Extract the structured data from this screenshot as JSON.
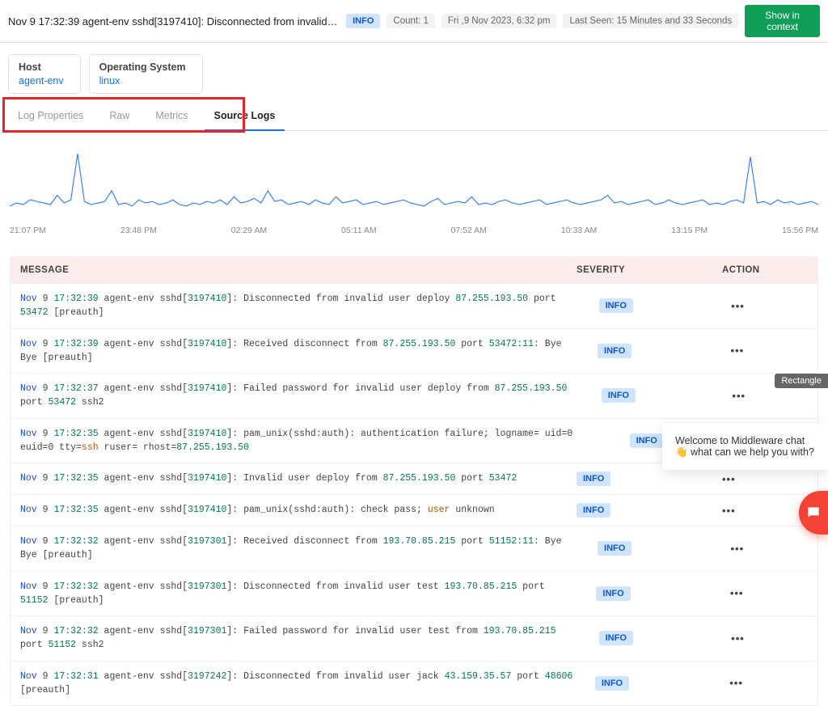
{
  "topbar": {
    "title": "Nov 9 17:32:39 agent-env sshd[3197410]: Disconnected from invalid user deploy 87.2...",
    "severity_badge": "INFO",
    "count_meta": "Count: 1",
    "date_meta": "Fri ,9 Nov 2023, 6:32 pm",
    "lastseen_meta": "Last Seen: 15 Minutes and 33 Seconds",
    "show_ctx_btn": "Show in context"
  },
  "infocards": [
    {
      "label": "Host",
      "value": "agent-env"
    },
    {
      "label": "Operating System",
      "value": "linux"
    }
  ],
  "tabs": [
    {
      "label": "Log Properties",
      "active": false
    },
    {
      "label": "Raw",
      "active": false
    },
    {
      "label": "Metrics",
      "active": false
    },
    {
      "label": "Source Logs",
      "active": true
    }
  ],
  "chart_data": {
    "type": "line",
    "title": "",
    "xlabel": "",
    "ylabel": "",
    "x_ticks": [
      "21:07 PM",
      "23:48 PM",
      "02:29 AM",
      "05:11 AM",
      "07:52 AM",
      "10:33 AM",
      "13:15 PM",
      "15:56 PM"
    ],
    "series": [
      {
        "name": "log volume",
        "values": [
          8,
          10,
          9,
          12,
          11,
          10,
          9,
          15,
          10,
          12,
          42,
          11,
          9,
          10,
          11,
          18,
          9,
          10,
          8,
          12,
          10,
          11,
          9,
          10,
          12,
          9,
          8,
          10,
          9,
          11,
          10,
          12,
          9,
          14,
          10,
          11,
          13,
          10,
          18,
          11,
          12,
          9,
          10,
          11,
          9,
          12,
          10,
          9,
          14,
          10,
          11,
          12,
          9,
          10,
          11,
          9,
          10,
          11,
          12,
          10,
          9,
          8,
          11,
          13,
          9,
          10,
          11,
          10,
          14,
          9,
          10,
          9,
          11,
          12,
          10,
          9,
          10,
          11,
          12,
          9,
          10,
          11,
          12,
          10,
          9,
          10,
          11,
          12,
          15,
          10,
          11,
          9,
          10,
          11,
          12,
          9,
          10,
          12,
          10,
          9,
          10,
          11,
          12,
          9,
          10,
          9,
          11,
          12,
          10,
          40,
          10,
          11,
          9,
          12,
          10,
          11,
          9,
          10,
          11,
          9
        ]
      }
    ],
    "ylim": [
      0,
      45
    ]
  },
  "logtable": {
    "headers": {
      "msg": "MESSAGE",
      "sev": "SEVERITY",
      "act": "ACTION"
    },
    "rows": [
      {
        "tokens": [
          {
            "t": "Nov",
            "c": "blue"
          },
          {
            "t": "  9 ",
            "c": ""
          },
          {
            "t": "17:32:39",
            "c": "teal"
          },
          {
            "t": " agent-env sshd[",
            "c": ""
          },
          {
            "t": "3197410",
            "c": "teal"
          },
          {
            "t": "]: Disconnected from invalid user deploy ",
            "c": ""
          },
          {
            "t": "87.255.193.50",
            "c": "teal"
          },
          {
            "t": " port ",
            "c": ""
          },
          {
            "t": "53472",
            "c": "teal"
          },
          {
            "t": " [preauth]",
            "c": ""
          }
        ],
        "severity": "INFO"
      },
      {
        "tokens": [
          {
            "t": "Nov",
            "c": "blue"
          },
          {
            "t": "  9 ",
            "c": ""
          },
          {
            "t": "17:32:39",
            "c": "teal"
          },
          {
            "t": " agent-env sshd[",
            "c": ""
          },
          {
            "t": "3197410",
            "c": "teal"
          },
          {
            "t": "]: Received disconnect from ",
            "c": ""
          },
          {
            "t": "87.255.193.50",
            "c": "teal"
          },
          {
            "t": " port ",
            "c": ""
          },
          {
            "t": "53472:11",
            "c": "teal"
          },
          {
            "t": ": Bye Bye [preauth]",
            "c": ""
          }
        ],
        "severity": "INFO"
      },
      {
        "tokens": [
          {
            "t": "Nov",
            "c": "blue"
          },
          {
            "t": "  9 ",
            "c": ""
          },
          {
            "t": "17:32:37",
            "c": "teal"
          },
          {
            "t": " agent-env sshd[",
            "c": ""
          },
          {
            "t": "3197410",
            "c": "teal"
          },
          {
            "t": "]: Failed password for invalid user deploy from ",
            "c": ""
          },
          {
            "t": "87.255.193.50",
            "c": "teal"
          },
          {
            "t": " port ",
            "c": ""
          },
          {
            "t": "53472",
            "c": "teal"
          },
          {
            "t": " ssh2",
            "c": ""
          }
        ],
        "severity": "INFO"
      },
      {
        "tokens": [
          {
            "t": "Nov",
            "c": "blue"
          },
          {
            "t": "  9 ",
            "c": ""
          },
          {
            "t": "17:32:35",
            "c": "teal"
          },
          {
            "t": " agent-env sshd[",
            "c": ""
          },
          {
            "t": "3197410",
            "c": "teal"
          },
          {
            "t": "]: pam_unix(sshd:auth): authentication failure; logname= uid=0 euid=0 tty=",
            "c": ""
          },
          {
            "t": "ssh",
            "c": "orange"
          },
          {
            "t": " ruser= rhost=",
            "c": ""
          },
          {
            "t": "87.255.193.50",
            "c": "teal"
          }
        ],
        "severity": "INFO"
      },
      {
        "tokens": [
          {
            "t": "Nov",
            "c": "blue"
          },
          {
            "t": "  9 ",
            "c": ""
          },
          {
            "t": "17:32:35",
            "c": "teal"
          },
          {
            "t": " agent-env sshd[",
            "c": ""
          },
          {
            "t": "3197410",
            "c": "teal"
          },
          {
            "t": "]: Invalid user deploy from ",
            "c": ""
          },
          {
            "t": "87.255.193.50",
            "c": "teal"
          },
          {
            "t": " port ",
            "c": ""
          },
          {
            "t": "53472",
            "c": "teal"
          }
        ],
        "severity": "INFO"
      },
      {
        "tokens": [
          {
            "t": "Nov",
            "c": "blue"
          },
          {
            "t": "  9 ",
            "c": ""
          },
          {
            "t": "17:32:35",
            "c": "teal"
          },
          {
            "t": " agent-env sshd[",
            "c": ""
          },
          {
            "t": "3197410",
            "c": "teal"
          },
          {
            "t": "]: pam_unix(sshd:auth): check pass; ",
            "c": ""
          },
          {
            "t": "user",
            "c": "orange"
          },
          {
            "t": " unknown",
            "c": ""
          }
        ],
        "severity": "INFO"
      },
      {
        "tokens": [
          {
            "t": "Nov",
            "c": "blue"
          },
          {
            "t": "  9 ",
            "c": ""
          },
          {
            "t": "17:32:32",
            "c": "teal"
          },
          {
            "t": " agent-env sshd[",
            "c": ""
          },
          {
            "t": "3197301",
            "c": "teal"
          },
          {
            "t": "]: Received disconnect from ",
            "c": ""
          },
          {
            "t": "193.70.85.215",
            "c": "teal"
          },
          {
            "t": " port ",
            "c": ""
          },
          {
            "t": "51152:11",
            "c": "teal"
          },
          {
            "t": ": Bye Bye [preauth]",
            "c": ""
          }
        ],
        "severity": "INFO"
      },
      {
        "tokens": [
          {
            "t": "Nov",
            "c": "blue"
          },
          {
            "t": "  9 ",
            "c": ""
          },
          {
            "t": "17:32:32",
            "c": "teal"
          },
          {
            "t": " agent-env sshd[",
            "c": ""
          },
          {
            "t": "3197301",
            "c": "teal"
          },
          {
            "t": "]: Disconnected from invalid user test ",
            "c": ""
          },
          {
            "t": "193.70.85.215",
            "c": "teal"
          },
          {
            "t": " port ",
            "c": ""
          },
          {
            "t": "51152",
            "c": "teal"
          },
          {
            "t": " [preauth]",
            "c": ""
          }
        ],
        "severity": "INFO"
      },
      {
        "tokens": [
          {
            "t": "Nov",
            "c": "blue"
          },
          {
            "t": "  9 ",
            "c": ""
          },
          {
            "t": "17:32:32",
            "c": "teal"
          },
          {
            "t": " agent-env sshd[",
            "c": ""
          },
          {
            "t": "3197301",
            "c": "teal"
          },
          {
            "t": "]: Failed password for invalid user test from ",
            "c": ""
          },
          {
            "t": "193.70.85.215",
            "c": "teal"
          },
          {
            "t": " port ",
            "c": ""
          },
          {
            "t": "51152",
            "c": "teal"
          },
          {
            "t": " ssh2",
            "c": ""
          }
        ],
        "severity": "INFO"
      },
      {
        "tokens": [
          {
            "t": "Nov",
            "c": "blue"
          },
          {
            "t": "  9 ",
            "c": ""
          },
          {
            "t": "17:32:31",
            "c": "teal"
          },
          {
            "t": " agent-env sshd[",
            "c": ""
          },
          {
            "t": "3197242",
            "c": "teal"
          },
          {
            "t": "]: Disconnected from invalid user jack ",
            "c": ""
          },
          {
            "t": "43.159.35.57",
            "c": "teal"
          },
          {
            "t": " port ",
            "c": ""
          },
          {
            "t": "48606",
            "c": "teal"
          },
          {
            "t": " [preauth]",
            "c": ""
          }
        ],
        "severity": "INFO"
      }
    ]
  },
  "rect_tooltip": "Rectangle",
  "chat": {
    "text_before_wave": "Welcome to Middleware chat ",
    "text_after_wave": " what can we help you with?"
  }
}
